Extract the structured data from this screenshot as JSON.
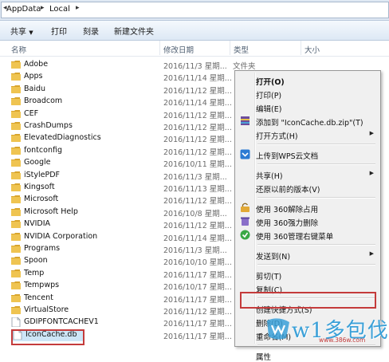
{
  "address": {
    "crumbs": [
      "AppData",
      "Local"
    ]
  },
  "toolbar": {
    "items": [
      "共享",
      "打印",
      "刻录",
      "新建文件夹"
    ]
  },
  "columns": {
    "name": "名称",
    "date": "修改日期",
    "type": "类型",
    "size": "大小"
  },
  "files": [
    {
      "name": "Adobe",
      "date": "2016/11/3 星期...",
      "type": "文件夹",
      "icon": "folder-icon"
    },
    {
      "name": "Apps",
      "date": "2016/11/14 星期...",
      "type": "",
      "icon": "folder-icon"
    },
    {
      "name": "Baidu",
      "date": "2016/11/12 星期...",
      "type": "",
      "icon": "folder-icon"
    },
    {
      "name": "Broadcom",
      "date": "2016/11/14 星期...",
      "type": "",
      "icon": "folder-icon"
    },
    {
      "name": "CEF",
      "date": "2016/11/12 星期...",
      "type": "",
      "icon": "folder-icon"
    },
    {
      "name": "CrashDumps",
      "date": "2016/11/12 星期...",
      "type": "",
      "icon": "folder-icon"
    },
    {
      "name": "ElevatedDiagnostics",
      "date": "2016/11/12 星期...",
      "type": "",
      "icon": "folder-icon"
    },
    {
      "name": "fontconfig",
      "date": "2016/11/12 星期...",
      "type": "",
      "icon": "folder-icon"
    },
    {
      "name": "Google",
      "date": "2016/10/11 星期...",
      "type": "",
      "icon": "folder-icon"
    },
    {
      "name": "iStylePDF",
      "date": "2016/11/3 星期...",
      "type": "",
      "icon": "folder-icon"
    },
    {
      "name": "Kingsoft",
      "date": "2016/11/13 星期...",
      "type": "",
      "icon": "folder-icon"
    },
    {
      "name": "Microsoft",
      "date": "2016/11/12 星期...",
      "type": "",
      "icon": "folder-icon"
    },
    {
      "name": "Microsoft Help",
      "date": "2016/10/8 星期...",
      "type": "",
      "icon": "folder-icon"
    },
    {
      "name": "NVIDIA",
      "date": "2016/11/12 星期...",
      "type": "",
      "icon": "folder-icon"
    },
    {
      "name": "NVIDIA Corporation",
      "date": "2016/11/14 星期...",
      "type": "",
      "icon": "folder-icon"
    },
    {
      "name": "Programs",
      "date": "2016/11/3 星期...",
      "type": "",
      "icon": "folder-icon"
    },
    {
      "name": "Spoon",
      "date": "2016/10/10 星期...",
      "type": "",
      "icon": "folder-icon"
    },
    {
      "name": "Temp",
      "date": "2016/11/17 星期...",
      "type": "",
      "icon": "folder-icon"
    },
    {
      "name": "Tempwps",
      "date": "2016/10/17 星期...",
      "type": "",
      "icon": "folder-icon"
    },
    {
      "name": "Tencent",
      "date": "2016/11/17 星期...",
      "type": "",
      "icon": "folder-icon"
    },
    {
      "name": "VirtualStore",
      "date": "2016/11/12 星期...",
      "type": "",
      "icon": "folder-icon"
    },
    {
      "name": "GDIPFONTCACHEV1",
      "date": "2016/11/17 星期...",
      "type": "",
      "icon": "file-icon"
    },
    {
      "name": "IconCache.db",
      "date": "2016/11/17 星期...",
      "type": "",
      "icon": "db-file-icon"
    }
  ],
  "context_menu": {
    "items": [
      {
        "label": "打开(O)",
        "bold": true,
        "arrow": false,
        "icon": ""
      },
      {
        "label": "打印(P)",
        "bold": false,
        "arrow": false,
        "icon": ""
      },
      {
        "label": "编辑(E)",
        "bold": false,
        "arrow": false,
        "icon": ""
      },
      {
        "label": "添加到 \"IconCache.db.zip\"(T)",
        "bold": false,
        "arrow": false,
        "icon": "archive-icon"
      },
      {
        "label": "打开方式(H)",
        "bold": false,
        "arrow": true,
        "icon": ""
      },
      {
        "sep": true
      },
      {
        "label": "上传到WPS云文档",
        "bold": false,
        "arrow": false,
        "icon": "wps-cloud-icon"
      },
      {
        "sep": true
      },
      {
        "label": "共享(H)",
        "bold": false,
        "arrow": true,
        "icon": ""
      },
      {
        "label": "还原以前的版本(V)",
        "bold": false,
        "arrow": false,
        "icon": ""
      },
      {
        "sep": true
      },
      {
        "label": "使用 360解除占用",
        "bold": false,
        "arrow": false,
        "icon": "unlock-360-icon"
      },
      {
        "label": "使用 360强力删除",
        "bold": false,
        "arrow": false,
        "icon": "delete-360-icon"
      },
      {
        "label": "使用 360管理右键菜单",
        "bold": false,
        "arrow": false,
        "icon": "menu-360-icon"
      },
      {
        "sep": true
      },
      {
        "label": "发送到(N)",
        "bold": false,
        "arrow": true,
        "icon": ""
      },
      {
        "sep": true
      },
      {
        "label": "剪切(T)",
        "bold": false,
        "arrow": false,
        "icon": ""
      },
      {
        "label": "复制(C)",
        "bold": false,
        "arrow": false,
        "icon": ""
      },
      {
        "sep": true
      },
      {
        "label": "创建快捷方式(S)",
        "bold": false,
        "arrow": false,
        "icon": ""
      },
      {
        "label": "删除(D)",
        "bold": false,
        "arrow": false,
        "icon": ""
      },
      {
        "label": "重命名(M)",
        "bold": false,
        "arrow": false,
        "icon": ""
      },
      {
        "sep": true
      },
      {
        "label": "属性",
        "bold": false,
        "arrow": false,
        "icon": ""
      }
    ]
  },
  "watermark": {
    "text": "w1多包伐",
    "url": "www.386w.com"
  },
  "colors": {
    "folder": "#e8b93c",
    "selection": "#cde6f7",
    "highlight_outline": "#c43b3b",
    "watermark": "#3aa0d8"
  }
}
